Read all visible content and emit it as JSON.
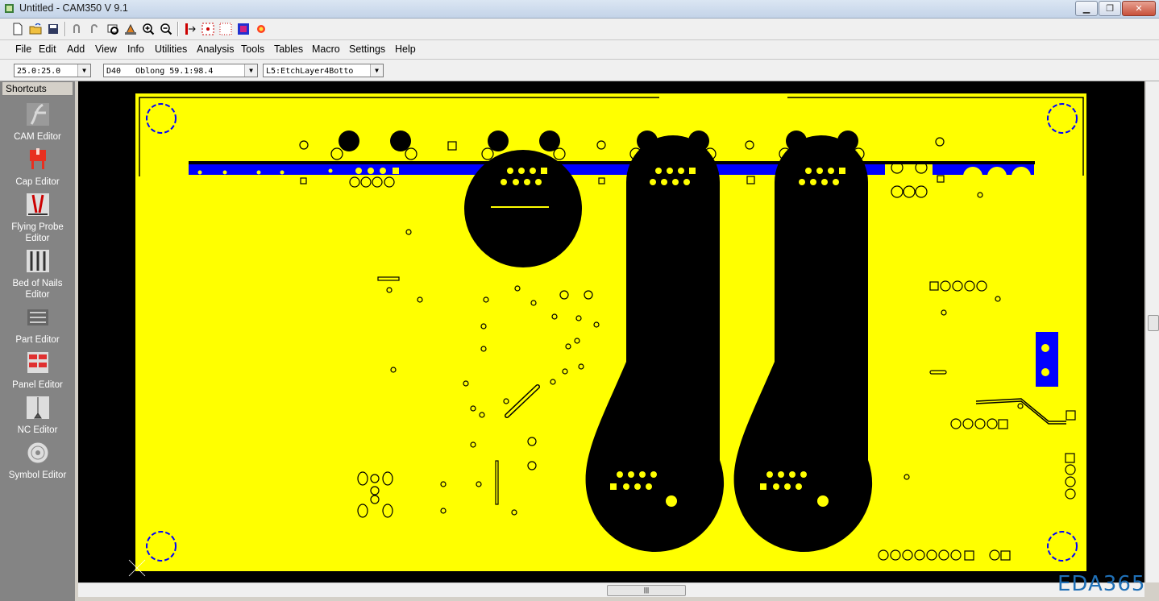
{
  "window": {
    "title": "Untitled - CAM350 V 9.1"
  },
  "toolbar": {
    "icons": [
      "new-file-icon",
      "open-folder-icon",
      "save-icon",
      "undo-icon",
      "redo-icon",
      "refresh-icon",
      "pan-icon",
      "zoom-in-icon",
      "zoom-out-icon",
      "layer-icon",
      "grid-icon",
      "snap-grid-icon",
      "color-icon",
      "highlight-icon"
    ]
  },
  "menu": [
    {
      "label": "File"
    },
    {
      "label": "Edit"
    },
    {
      "label": "Add"
    },
    {
      "label": "View"
    },
    {
      "label": "Info"
    },
    {
      "label": "Utilities"
    },
    {
      "label": "Analysis"
    },
    {
      "label": "Tools"
    },
    {
      "label": "Tables"
    },
    {
      "label": "Macro"
    },
    {
      "label": "Settings"
    },
    {
      "label": "Help"
    }
  ],
  "combos": {
    "grid": "25.0:25.0",
    "dcode": "D40   Oblong 59.1:98.4",
    "layer": "L5:EtchLayer4Botto"
  },
  "sidebar": {
    "header": "Shortcuts",
    "items": [
      {
        "label": "CAM Editor",
        "icon": "cam-editor-icon"
      },
      {
        "label": "Cap Editor",
        "icon": "cap-editor-icon"
      },
      {
        "label": "Flying Probe Editor",
        "icon": "flying-probe-icon"
      },
      {
        "label": "Bed of Nails Editor",
        "icon": "bed-of-nails-icon"
      },
      {
        "label": "Part Editor",
        "icon": "part-editor-icon"
      },
      {
        "label": "Panel Editor",
        "icon": "panel-editor-icon"
      },
      {
        "label": "NC Editor",
        "icon": "nc-editor-icon"
      },
      {
        "label": "Symbol Editor",
        "icon": "symbol-editor-icon"
      }
    ]
  },
  "colors": {
    "board": "#ffff00",
    "background": "#000000",
    "traces": "#0000ff"
  },
  "watermark": "EDA365",
  "hscroll_thumb": "|||"
}
